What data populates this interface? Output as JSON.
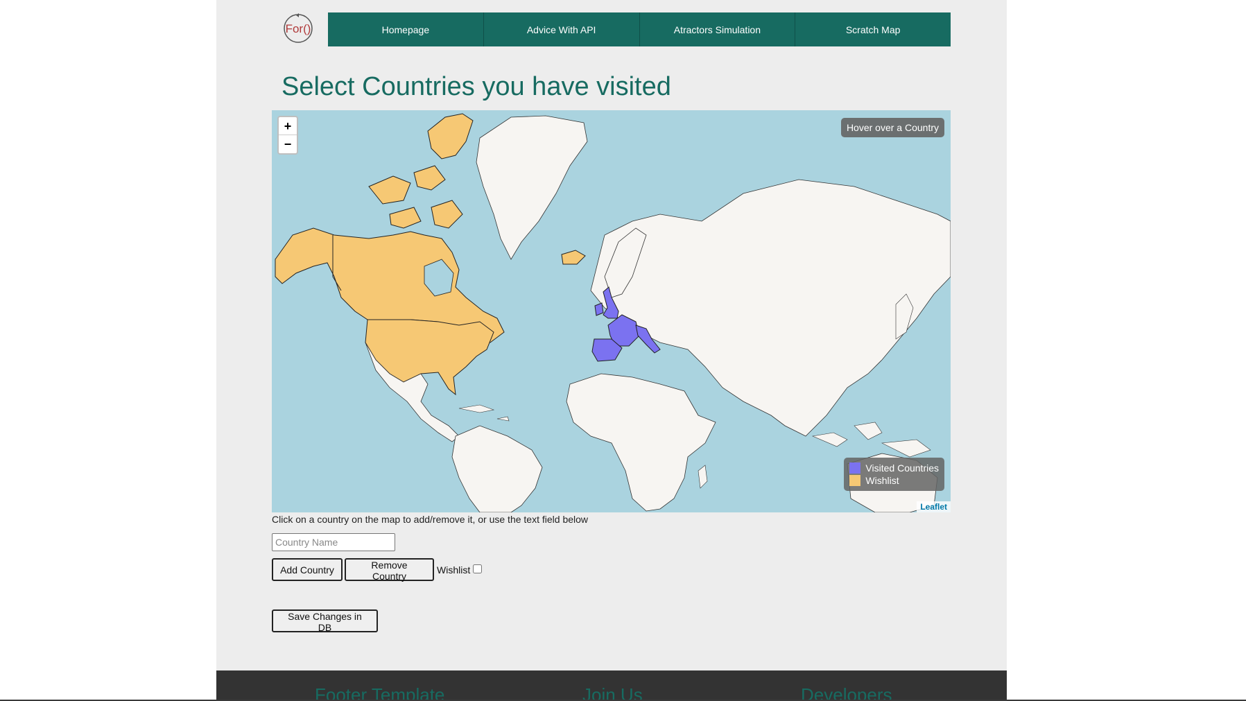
{
  "logo": {
    "text": "For()"
  },
  "nav": {
    "items": [
      {
        "label": "Homepage"
      },
      {
        "label": "Advice With API"
      },
      {
        "label": "Atractors Simulation"
      },
      {
        "label": "Scratch Map"
      }
    ]
  },
  "title": "Select Countries you have visited",
  "map": {
    "zoom_in": "+",
    "zoom_out": "−",
    "hover_info": "Hover over a Country",
    "legend": {
      "visited_label": "Visited Countries",
      "wishlist_label": "Wishlist"
    },
    "attribution": "Leaflet",
    "colors": {
      "ocean": "#aad3df",
      "land": "#f7f5f2",
      "visited": "#7b72f0",
      "wishlist": "#f6c874",
      "border": "#222222"
    }
  },
  "help_text": "Click on a country on the map to add/remove it, or use the text field below",
  "form": {
    "country_placeholder": "Country Name",
    "add_label": "Add Country",
    "remove_label": "Remove Country",
    "wishlist_label": "Wishlist",
    "save_label": "Save Changes in DB"
  },
  "footer": {
    "columns": [
      {
        "title": "Footer Template"
      },
      {
        "title": "Join Us"
      },
      {
        "title": "Developers"
      }
    ]
  }
}
